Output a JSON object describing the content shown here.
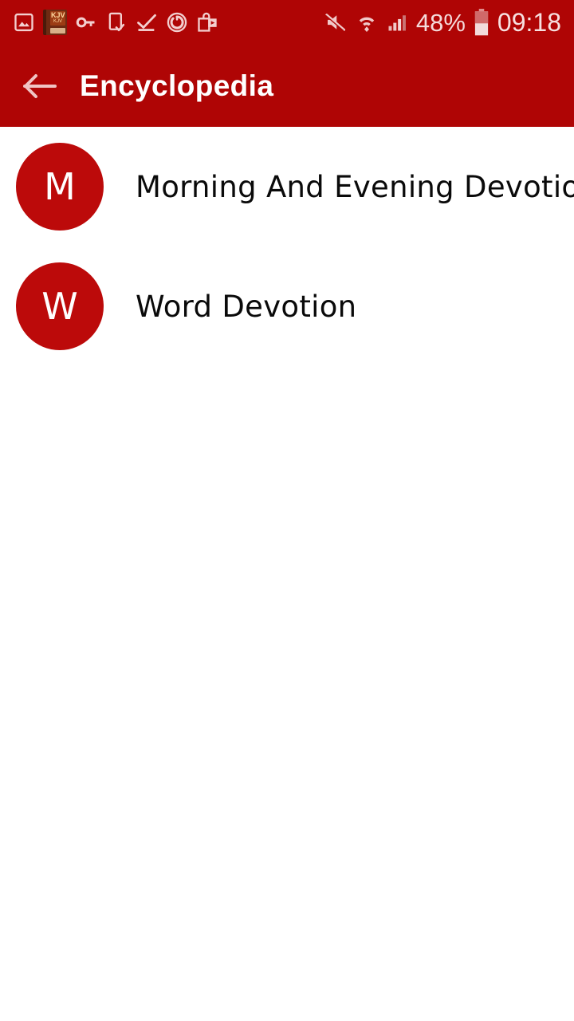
{
  "status_bar": {
    "background_color": "#af0505",
    "left_icons": [
      {
        "name": "image-icon",
        "label": "Screenshot saved"
      },
      {
        "name": "bible-book-icon",
        "label": "KJV",
        "sublabel": "KJV"
      },
      {
        "name": "key-icon",
        "label": "VPN key"
      },
      {
        "name": "phone-check-icon",
        "label": "Device check"
      },
      {
        "name": "download-complete-icon",
        "label": "Download complete"
      },
      {
        "name": "power-sync-icon",
        "label": "Sync"
      },
      {
        "name": "play-store-bag-icon",
        "label": "Play Store"
      }
    ],
    "right_icons": [
      {
        "name": "mute-icon",
        "label": "Sound muted"
      },
      {
        "name": "wifi-icon",
        "label": "Wi-Fi connected"
      },
      {
        "name": "cellular-signal-icon",
        "label": "Signal"
      }
    ],
    "battery_percent": "48%",
    "battery_level": 48,
    "clock": "09:18"
  },
  "app_bar": {
    "title": "Encyclopedia",
    "back_icon": "arrow-left-icon",
    "background_color": "#af0505",
    "title_color": "#ffffff",
    "back_icon_color": "#f0c4c4"
  },
  "list": {
    "background_color": "#ffffff",
    "avatar_color": "#bc0a0a",
    "items": [
      {
        "initial": "M",
        "title": "Morning And Evening Devotion"
      },
      {
        "initial": "W",
        "title": "Word Devotion"
      }
    ]
  }
}
